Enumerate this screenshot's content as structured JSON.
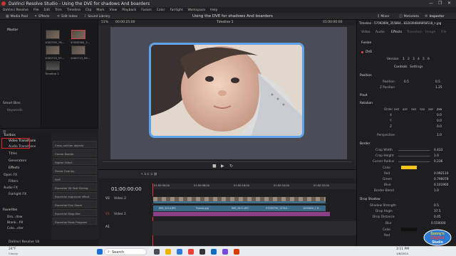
{
  "window": {
    "title": "DaVinci Resolve Studio - Using the DVE for shadows And boarders",
    "controls": [
      "—",
      "❐",
      "✕"
    ]
  },
  "menu": [
    "DaVinci Resolve",
    "File",
    "Edit",
    "Trim",
    "Timeline",
    "Clip",
    "Mark",
    "View",
    "Playback",
    "Fusion",
    "Color",
    "Fairlight",
    "Workspace",
    "Help"
  ],
  "toolbar": {
    "media_pool": "Media Pool",
    "effects": "Effects",
    "edit_index": "Edit Index",
    "sound_library": "Sound Library",
    "project_title": "Using the DVE for shadows And boarders",
    "mixer": "Mixer",
    "metadata": "Metadata",
    "inspector": "Inspector"
  },
  "media": {
    "bin": "Master",
    "clips": [
      "1000700_76...",
      "57090384_3...",
      "1000715_57...",
      "1000713_56...",
      "Timeline 1"
    ],
    "smart_bins": "Smart Bins",
    "keywords": "Keywords"
  },
  "viewer": {
    "zoom": "51%",
    "timecode_left": "00:00:25:00",
    "timeline_name": "Timeline 1",
    "timecode_right": "01:00:00:00"
  },
  "effects_panel": {
    "header": "Toolbox",
    "categories": [
      "Video Transitions",
      "Audio Transitions",
      "Titles",
      "Generators",
      "Effects"
    ],
    "open_fx_header": "Open FX",
    "open_fx": [
      "Filters"
    ],
    "audio_fx_header": "Audio FX",
    "audio_fx": [
      "Fairlight FX"
    ],
    "favorites_header": "Favorites",
    "favorites": [
      "Dro...dow",
      "Blank...fill",
      "Colo...ster"
    ],
    "list": [
      "Cross-section objects",
      "Corner Border",
      "Digital Glitch",
      "Drone Overlay",
      "DVE",
      "Essential 3D Text Sliding",
      "Essential engraved effect",
      "Essential Flex Zoom",
      "Essential Magnifier",
      "Essential Mask Program"
    ]
  },
  "inspector": {
    "clip_name": "Timeline - 57092894_355864...8326394846958518_n.jpg",
    "tabs": [
      "Video",
      "Audio",
      "Effects",
      "Transition",
      "Image",
      "File"
    ],
    "subtabs": [
      "Fusion"
    ],
    "effect": "DVE",
    "version_label": "Version",
    "versions": [
      "1",
      "2",
      "3",
      "4",
      "5",
      "6"
    ],
    "controls_tab": "Controls",
    "settings_tab": "Settings",
    "sections": {
      "position": {
        "title": "Position",
        "position_label": "Position",
        "pos_x": "0.5",
        "pos_y": "0.5",
        "zpos_label": "Z Position",
        "zpos": "1.25"
      },
      "pivot": {
        "title": "Pivot"
      },
      "rotation": {
        "title": "Rotation",
        "order_label": "Order",
        "order_opts": [
          "XYZ",
          "XZY",
          "YXZ",
          "YZX",
          "ZXY",
          "ZYX"
        ],
        "x_label": "X",
        "y_label": "Y",
        "z_label": "Z",
        "x": "0.0",
        "y": "0.0",
        "z": "0.0",
        "perspective_label": "Perspective",
        "perspective": "1.0"
      },
      "border": {
        "title": "Border",
        "crop_width_label": "Crop Width",
        "crop_width": "0.433",
        "crop_height_label": "Crop Height",
        "crop_height": "1.0",
        "corner_radius_label": "Corner Radius",
        "corner_radius": "0.236",
        "color_label": "Color",
        "red_label": "Red",
        "red": "0.092110",
        "green_label": "Green",
        "green": "0.796078",
        "blue_label": "Blue",
        "blue": "0.101960",
        "blend_label": "Border Blend",
        "blend": "1.0"
      },
      "drop_shadow": {
        "title": "Drop Shadow",
        "strength_label": "Shadow Strength",
        "strength": "0.5",
        "angle_label": "Drop Angle",
        "angle": "37.5",
        "distance_label": "Drop Distance",
        "distance": "0.05",
        "blur_label": "Blur",
        "blur": "0.550000",
        "color_label": "Color",
        "red_label": "Red",
        "red": "0.0"
      }
    },
    "colors": {
      "border_swatch": "#f5c518",
      "shadow_swatch": "#111111"
    }
  },
  "timeline": {
    "timecode": "01:00:00:00",
    "ruler": [
      "01:00:00:00",
      "01:00:08:00",
      "01:00:16:00",
      "01:00:24:00",
      "01:00:32:00",
      "01:00:40:00"
    ],
    "tracks": [
      {
        "id": "V2",
        "name": "Video 2"
      },
      {
        "id": "V1",
        "name": "Video 1"
      },
      {
        "id": "A1",
        "name": ""
      }
    ],
    "v1_clips": [
      "IMG_3414.JPG",
      "Fornaa.jpg",
      "IMG_3411.JPG",
      "57090750_13744...",
      "1000694_1 8..."
    ]
  },
  "status_bar": {
    "app_label": "DaVinci Resolve 18"
  },
  "taskbar": {
    "weather_temp": "24°F",
    "weather_desc": "Cloudy",
    "search_placeholder": "Search",
    "time": "3:11 PM",
    "date": "1/8/2024"
  },
  "watermark": {
    "line1": "Sonny's",
    "line2": "Digital",
    "line3": "Studio"
  }
}
